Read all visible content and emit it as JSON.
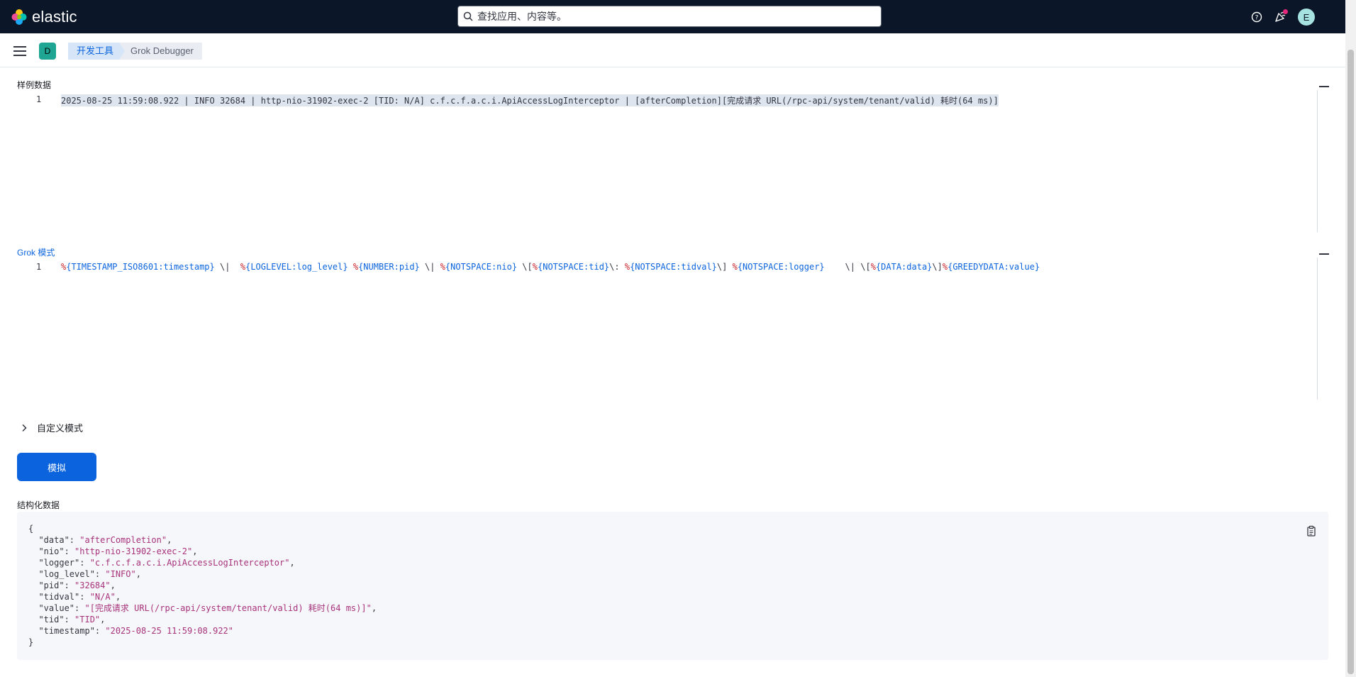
{
  "header": {
    "logo_text": "elastic",
    "search_placeholder": "查找应用、内容等。",
    "avatar_initial": "E"
  },
  "subheader": {
    "space_initial": "D",
    "breadcrumbs": [
      "开发工具",
      "Grok Debugger"
    ]
  },
  "sample": {
    "label": "样例数据",
    "line_number": "1",
    "text": "2025-08-25 11:59:08.922 | INFO 32684 | http-nio-31902-exec-2 [TID: N/A] c.f.c.f.a.c.i.ApiAccessLogInterceptor | [afterCompletion][完成请求 URL(/rpc-api/system/tenant/valid) 耗时(64 ms)]"
  },
  "grok": {
    "label": "Grok 模式",
    "line_number": "1",
    "pattern": "%{TIMESTAMP_ISO8601:timestamp} \\|  %{LOGLEVEL:log_level} %{NUMBER:pid} \\| %{NOTSPACE:nio} \\[%{NOTSPACE:tid}\\: %{NOTSPACE:tidval}\\] %{NOTSPACE:logger}    \\| \\[%{DATA:data}\\]%{GREEDYDATA:value}"
  },
  "custom_patterns": {
    "label": "自定义模式"
  },
  "simulate_button": {
    "label": "模拟"
  },
  "output": {
    "label": "结构化数据",
    "fields": [
      {
        "key": "data",
        "value": "afterCompletion"
      },
      {
        "key": "nio",
        "value": "http-nio-31902-exec-2"
      },
      {
        "key": "logger",
        "value": "c.f.c.f.a.c.i.ApiAccessLogInterceptor"
      },
      {
        "key": "log_level",
        "value": "INFO"
      },
      {
        "key": "pid",
        "value": "32684"
      },
      {
        "key": "tidval",
        "value": "N/A"
      },
      {
        "key": "value",
        "value": "[完成请求 URL(/rpc-api/system/tenant/valid) 耗时(64 ms)]"
      },
      {
        "key": "tid",
        "value": "TID"
      },
      {
        "key": "timestamp",
        "value": "2025-08-25 11:59:08.922"
      }
    ]
  },
  "colors": {
    "header_bg": "#0b1628",
    "accent": "#0b64dd",
    "string": "#a8327c",
    "notification": "#e4277a"
  },
  "icons": [
    "elastic-logo-icon",
    "search-icon",
    "help-icon",
    "newsfeed-icon",
    "menu-icon",
    "chevron-right-icon",
    "copy-icon"
  ]
}
